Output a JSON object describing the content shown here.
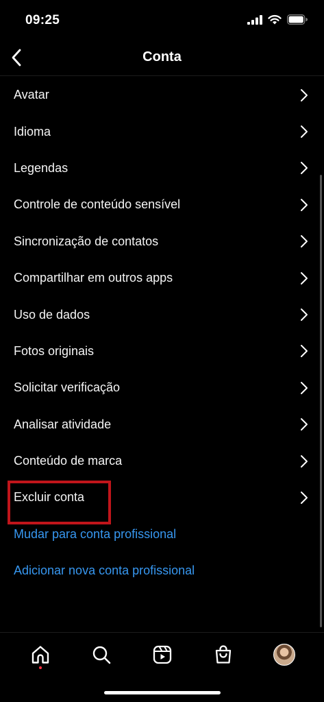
{
  "status_bar": {
    "time": "09:25"
  },
  "header": {
    "title": "Conta"
  },
  "menu": {
    "items": [
      {
        "label": "Avatar"
      },
      {
        "label": "Idioma"
      },
      {
        "label": "Legendas"
      },
      {
        "label": "Controle de conteúdo sensível"
      },
      {
        "label": "Sincronização de contatos"
      },
      {
        "label": "Compartilhar em outros apps"
      },
      {
        "label": "Uso de dados"
      },
      {
        "label": "Fotos originais"
      },
      {
        "label": "Solicitar verificação"
      },
      {
        "label": "Analisar atividade"
      },
      {
        "label": "Conteúdo de marca"
      },
      {
        "label": "Excluir conta"
      }
    ],
    "links": [
      {
        "label": "Mudar para conta profissional"
      },
      {
        "label": "Adicionar nova conta profissional"
      }
    ]
  },
  "tabs": [
    "home-icon",
    "search-icon",
    "reels-icon",
    "shop-icon",
    "profile-avatar"
  ],
  "colors": {
    "background": "#000000",
    "link": "#3797f0",
    "highlight_box": "#c0151b",
    "notification_dot": "#ff3040"
  }
}
